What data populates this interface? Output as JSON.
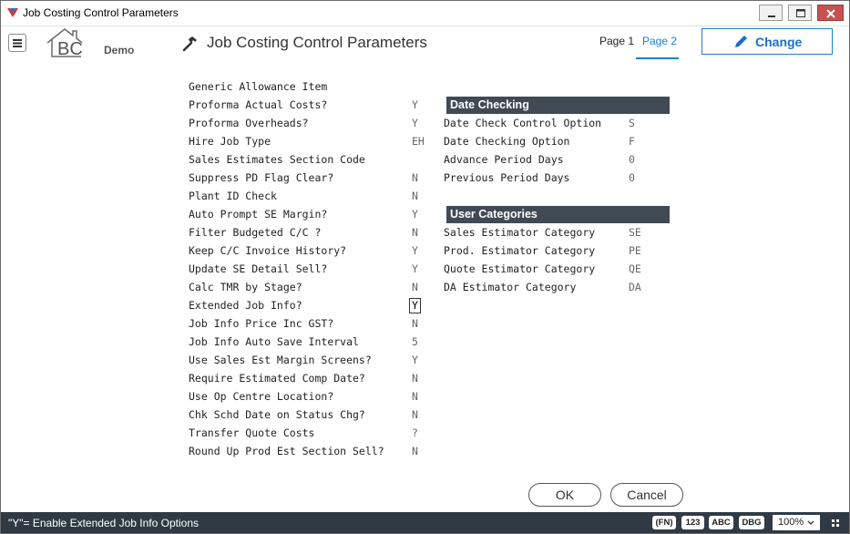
{
  "window": {
    "title": "Job Costing Control Parameters"
  },
  "header": {
    "logo_text": "BC",
    "demo_label": "Demo",
    "page_title": "Job Costing Control Parameters",
    "tabs": [
      {
        "label": "Page 1",
        "active": false
      },
      {
        "label": "Page 2",
        "active": true
      }
    ],
    "change_label": "Change",
    "accent_color": "#1a7fd6"
  },
  "left_params": [
    {
      "label": "Generic Allowance Item",
      "value": ""
    },
    {
      "label": "Proforma Actual Costs?",
      "value": "Y"
    },
    {
      "label": "Proforma Overheads?",
      "value": "Y"
    },
    {
      "label": "Hire Job Type",
      "value": "EH"
    },
    {
      "label": "Sales Estimates Section Code",
      "value": ""
    },
    {
      "label": "Suppress PD Flag Clear?",
      "value": "N"
    },
    {
      "label": "Plant ID Check",
      "value": "N"
    },
    {
      "label": "Auto Prompt SE Margin?",
      "value": "Y"
    },
    {
      "label": "Filter Budgeted C/C ?",
      "value": "N"
    },
    {
      "label": "Keep C/C Invoice History?",
      "value": "Y"
    },
    {
      "label": "Update SE Detail Sell?",
      "value": "Y"
    },
    {
      "label": "Calc TMR by Stage?",
      "value": "N"
    },
    {
      "label": "Extended Job Info?",
      "value": "Y",
      "focused": true
    },
    {
      "label": "Job Info Price Inc GST?",
      "value": "N"
    },
    {
      "label": "Job Info Auto Save Interval",
      "value": "5"
    },
    {
      "label": "Use Sales Est Margin Screens?",
      "value": "Y"
    },
    {
      "label": "Require Estimated Comp Date?",
      "value": "N"
    },
    {
      "label": "Use Op Centre Location?",
      "value": "N"
    },
    {
      "label": "Chk Schd Date on Status Chg?",
      "value": "N"
    },
    {
      "label": "Transfer Quote Costs",
      "value": "?"
    },
    {
      "label": "Round Up Prod Est Section Sell?",
      "value": "N"
    }
  ],
  "date_checking": {
    "header": "Date Checking",
    "rows": [
      {
        "label": "Date Check Control Option",
        "value": "S"
      },
      {
        "label": "Date Checking Option",
        "value": "F"
      },
      {
        "label": "Advance Period Days",
        "value": "0"
      },
      {
        "label": "Previous Period Days",
        "value": "0"
      }
    ]
  },
  "user_categories": {
    "header": "User Categories",
    "rows": [
      {
        "label": "Sales Estimator Category",
        "value": "SE"
      },
      {
        "label": "Prod. Estimator Category",
        "value": "PE"
      },
      {
        "label": "Quote Estimator Category",
        "value": "QE"
      },
      {
        "label": "DA Estimator Category",
        "value": "DA"
      }
    ]
  },
  "buttons": {
    "ok": "OK",
    "cancel": "Cancel"
  },
  "status": {
    "message": "\"Y\"= Enable Extended Job Info Options",
    "keys": [
      "(FN)",
      "123",
      "ABC",
      "DBG"
    ],
    "zoom": "100%"
  }
}
